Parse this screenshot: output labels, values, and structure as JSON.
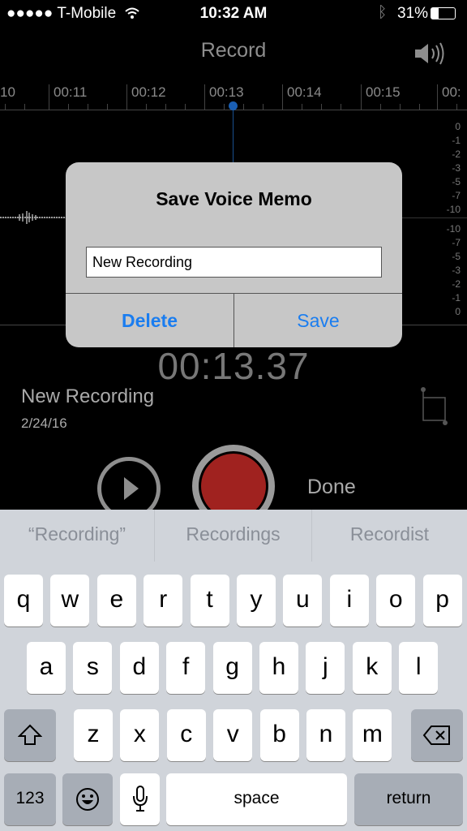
{
  "status": {
    "carrier": "●●●●● T-Mobile",
    "time": "10:32 AM",
    "battery": "31%",
    "battery_level": 0.31
  },
  "header": {
    "title": "Record"
  },
  "timeline": {
    "labels": [
      "10",
      "00:11",
      "00:12",
      "00:13",
      "00:14",
      "00:15",
      "00:"
    ],
    "playhead_color": "#1a5fb4"
  },
  "meter": {
    "top": [
      "0",
      "-1",
      "-2",
      "-3",
      "-5",
      "-7",
      "-10"
    ],
    "bottom": [
      "-10",
      "-7",
      "-5",
      "-3",
      "-2",
      "-1",
      "0"
    ]
  },
  "dialog": {
    "title": "Save Voice Memo",
    "input_value": "New Recording",
    "delete_label": "Delete",
    "save_label": "Save",
    "accent": "#1a7df0"
  },
  "recording": {
    "timer": "00:13.37",
    "name": "New Recording",
    "date": "2/24/16",
    "done_label": "Done",
    "record_color": "#a0221f"
  },
  "keyboard": {
    "suggestions": [
      "“Recording”",
      "Recordings",
      "Recordist"
    ],
    "row1": [
      "q",
      "w",
      "e",
      "r",
      "t",
      "y",
      "u",
      "i",
      "o",
      "p"
    ],
    "row2": [
      "a",
      "s",
      "d",
      "f",
      "g",
      "h",
      "j",
      "k",
      "l"
    ],
    "row3": [
      "z",
      "x",
      "c",
      "v",
      "b",
      "n",
      "m"
    ],
    "numbers_label": "123",
    "space_label": "space",
    "return_label": "return"
  }
}
